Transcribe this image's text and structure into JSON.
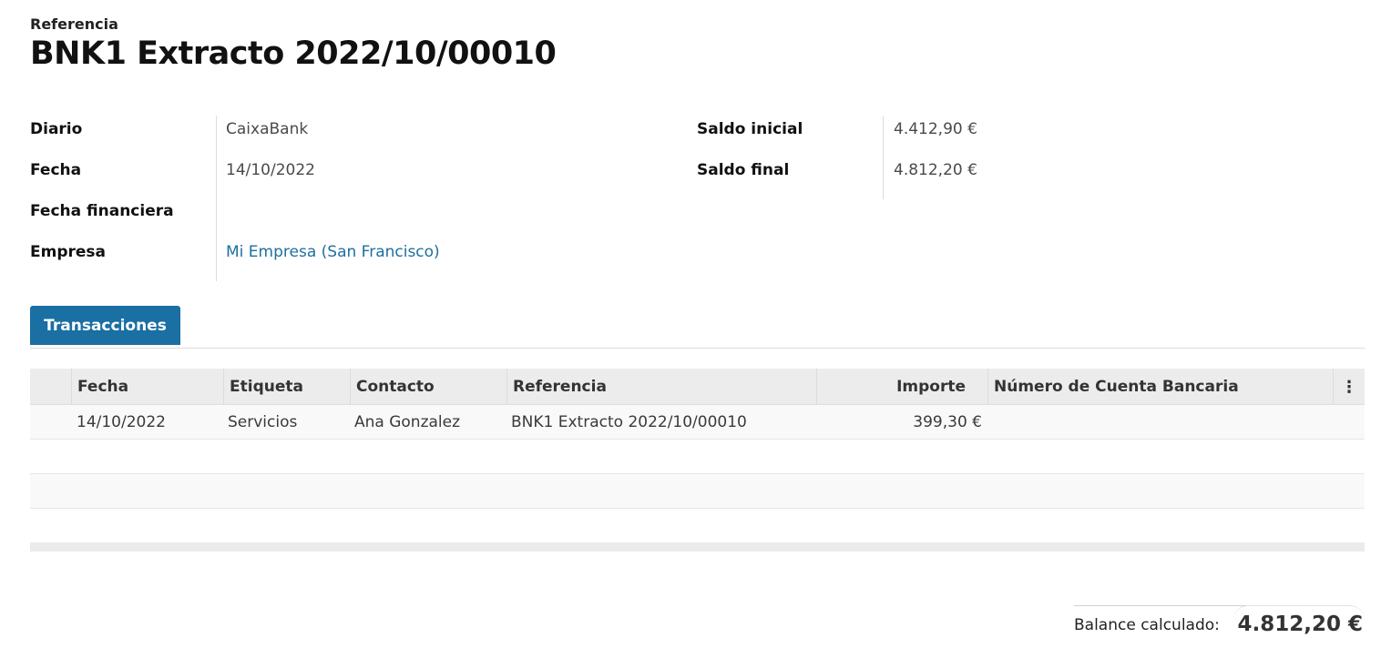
{
  "header": {
    "reference_label": "Referencia",
    "title": "BNK1 Extracto 2022/10/00010"
  },
  "fields_left": [
    {
      "label": "Diario",
      "value": "CaixaBank"
    },
    {
      "label": "Fecha",
      "value": "14/10/2022"
    },
    {
      "label": "Fecha financiera",
      "value": ""
    },
    {
      "label": "Empresa",
      "value": "Mi Empresa (San Francisco)"
    }
  ],
  "fields_right": [
    {
      "label": "Saldo inicial",
      "value": "4.412,90 €"
    },
    {
      "label": "Saldo final",
      "value": "4.812,20 €"
    }
  ],
  "tabs": [
    {
      "label": "Transacciones",
      "active": true
    }
  ],
  "table": {
    "columns": [
      "Fecha",
      "Etiqueta",
      "Contacto",
      "Referencia",
      "Importe",
      "Número de Cuenta Bancaria"
    ],
    "rows": [
      {
        "fecha": "14/10/2022",
        "etiqueta": "Servicios",
        "contacto": "Ana Gonzalez",
        "referencia": "BNK1 Extracto 2022/10/00010",
        "importe": "399,30 €",
        "cuenta": ""
      }
    ]
  },
  "footer": {
    "balance_label": "Balance calculado:",
    "balance_value": "4.812,20 €"
  },
  "colors": {
    "accent": "#1a6fa3",
    "link": "#1f6f9e"
  }
}
